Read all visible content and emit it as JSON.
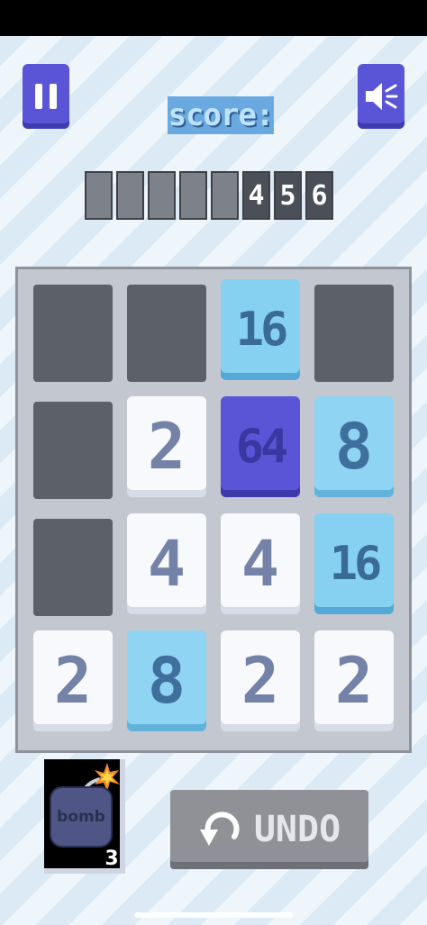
{
  "header": {
    "pause_icon": "pause-icon",
    "sound_icon": "speaker-icon",
    "score_label": "score:"
  },
  "score": {
    "digits": [
      "",
      "",
      "",
      "",
      "",
      "4",
      "5",
      "6"
    ]
  },
  "board": {
    "rows": 4,
    "cols": 4,
    "tiles": [
      [
        null,
        null,
        "16",
        null
      ],
      [
        null,
        "2",
        "64",
        "8"
      ],
      [
        null,
        "4",
        "4",
        "16"
      ],
      [
        "2",
        "8",
        "2",
        "2"
      ]
    ]
  },
  "powerups": {
    "bomb_label": "bomb",
    "bomb_count": "3"
  },
  "undo": {
    "label": "UNDO"
  },
  "colors": {
    "accent": "#5a55d6",
    "empty_cell": "#5b6069",
    "tile_light": "#f7f9fc",
    "tile_blue": "#8fd4f2"
  }
}
